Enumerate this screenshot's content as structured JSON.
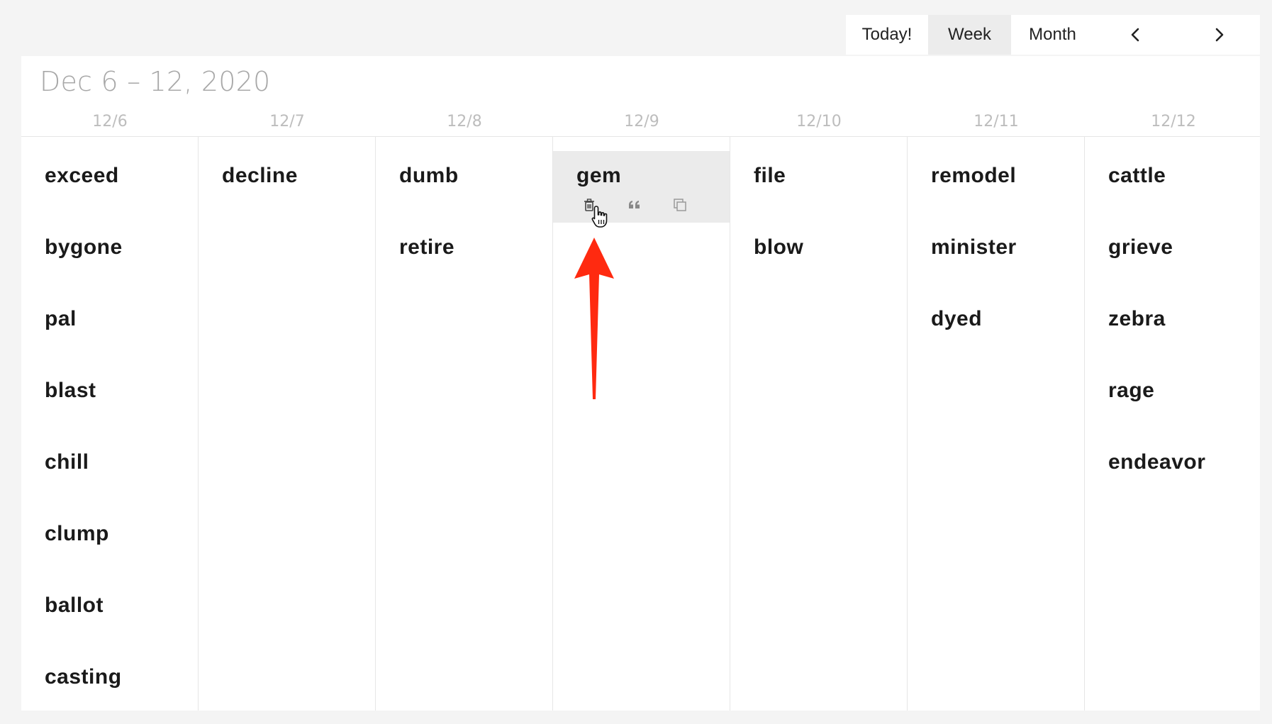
{
  "toolbar": {
    "today_label": "Today!",
    "week_label": "Week",
    "month_label": "Month",
    "active_view": "Week",
    "prev_icon": "chevron-left-icon",
    "next_icon": "chevron-right-icon"
  },
  "range_title": "Dec 6 – 12, 2020",
  "days": [
    {
      "header": "12/6",
      "entries": [
        "exceed",
        "bygone",
        "pal",
        "blast",
        "chill",
        "clump",
        "ballot",
        "casting"
      ]
    },
    {
      "header": "12/7",
      "entries": [
        "decline"
      ]
    },
    {
      "header": "12/8",
      "entries": [
        "dumb",
        "retire"
      ]
    },
    {
      "header": "12/9",
      "entries": [
        "gem"
      ]
    },
    {
      "header": "12/10",
      "entries": [
        "file",
        "blow"
      ]
    },
    {
      "header": "12/11",
      "entries": [
        "remodel",
        "minister",
        "dyed"
      ]
    },
    {
      "header": "12/12",
      "entries": [
        "cattle",
        "grieve",
        "zebra",
        "rage",
        "endeavor"
      ]
    }
  ],
  "hovered_entry": {
    "day_index": 3,
    "entry_index": 0,
    "actions": [
      {
        "name": "delete",
        "icon": "trash-icon"
      },
      {
        "name": "quote",
        "icon": "quote-icon"
      },
      {
        "name": "copy",
        "icon": "copy-icon"
      }
    ]
  },
  "colors": {
    "hover_bg": "#ebebeb",
    "active_tab_bg": "#ececec",
    "annotation_arrow": "#ff2a10",
    "muted_text": "#bdbdbd"
  }
}
